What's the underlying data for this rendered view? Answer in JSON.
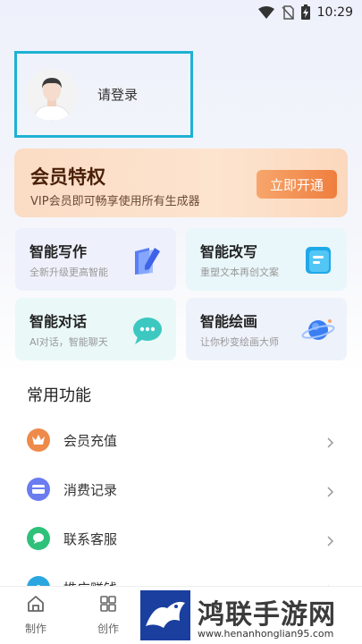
{
  "status_bar": {
    "time": "10:29"
  },
  "login": {
    "text": "请登录"
  },
  "vip": {
    "title": "会员特权",
    "subtitle": "VIP会员即可畅享使用所有生成器",
    "button": "立即开通"
  },
  "features": [
    {
      "title": "智能写作",
      "subtitle": "全新升级更高智能"
    },
    {
      "title": "智能改写",
      "subtitle": "重塑文本再创文案"
    },
    {
      "title": "智能对话",
      "subtitle": "AI对话，智能聊天"
    },
    {
      "title": "智能绘画",
      "subtitle": "让你秒变绘画大师"
    }
  ],
  "common": {
    "title": "常用功能",
    "items": [
      {
        "label": "会员充值",
        "icon": "crown-icon",
        "color": "#ee8a4a"
      },
      {
        "label": "消费记录",
        "icon": "card-icon",
        "color": "#6b7cf0"
      },
      {
        "label": "联系客服",
        "icon": "chat-icon",
        "color": "#2fc17a"
      },
      {
        "label": "推广赚钱",
        "icon": "share-icon",
        "color": "#2aa6e0"
      }
    ]
  },
  "bottom_nav": [
    {
      "label": "制作",
      "icon": "home-icon"
    },
    {
      "label": "创作",
      "icon": "grid-icon"
    }
  ],
  "watermark": {
    "text": "鸿联手游网",
    "url": "www.henanhonglian95.com"
  }
}
